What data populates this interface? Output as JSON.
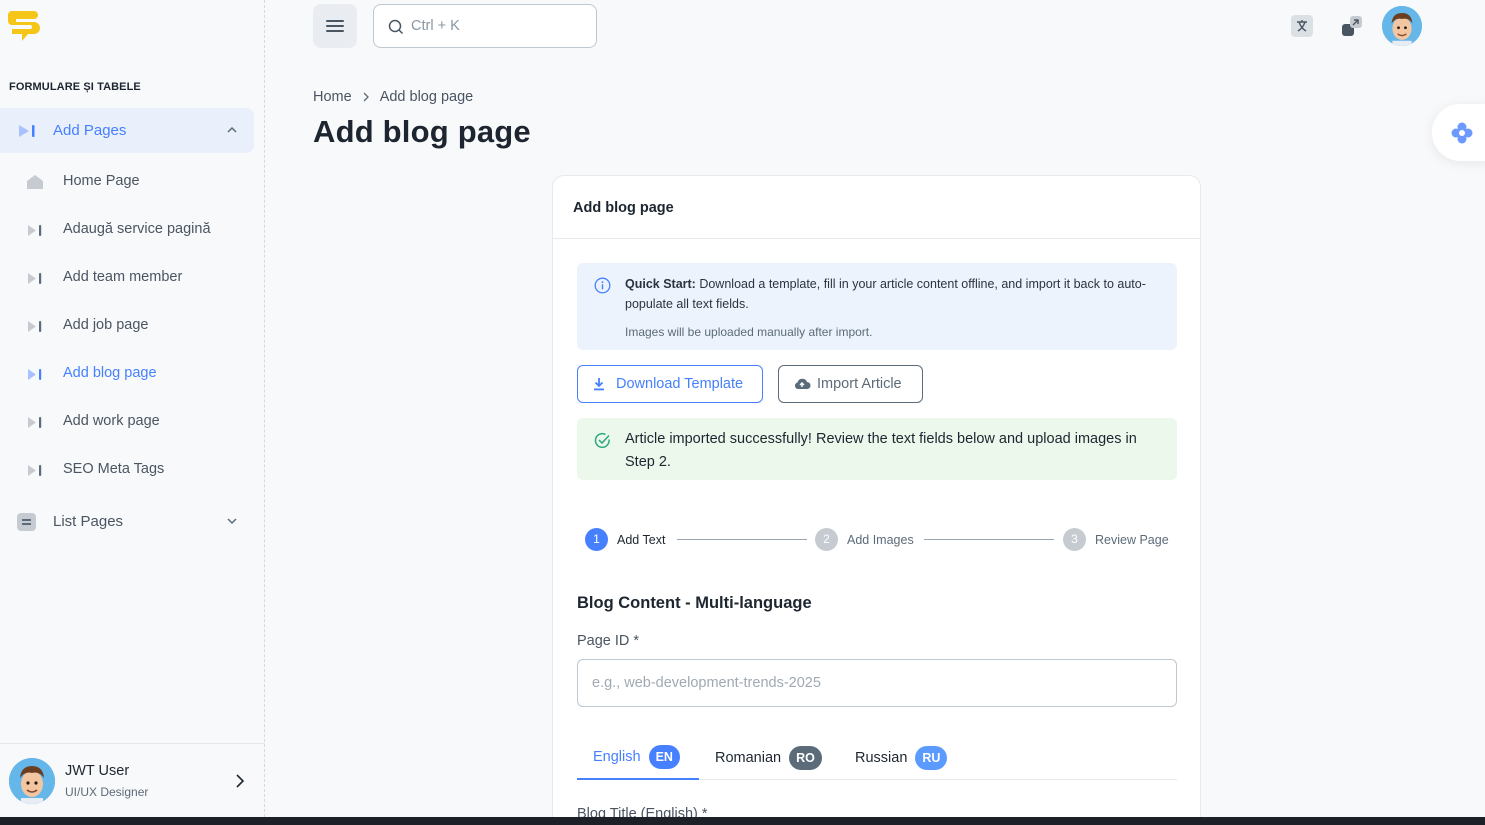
{
  "sidebar": {
    "section_label": "FORMULARE ȘI TABELE",
    "parent": {
      "label": "Add Pages",
      "icon": "play-bar-icon"
    },
    "items": [
      {
        "label": "Home Page",
        "icon": "home-icon"
      },
      {
        "label": "Adaugă service pagină",
        "icon": "play-bar-icon"
      },
      {
        "label": "Add team member",
        "icon": "play-bar-icon"
      },
      {
        "label": "Add job page",
        "icon": "play-bar-icon"
      },
      {
        "label": "Add blog page",
        "icon": "play-bar-icon",
        "active": true
      },
      {
        "label": "Add work page",
        "icon": "play-bar-icon"
      },
      {
        "label": "SEO Meta Tags",
        "icon": "play-bar-icon"
      }
    ],
    "list_parent": {
      "label": "List Pages",
      "icon": "list-icon"
    },
    "user": {
      "name": "JWT User",
      "role": "UI/UX Designer"
    }
  },
  "header": {
    "search_placeholder": "Ctrl + K"
  },
  "breadcrumb": {
    "home": "Home",
    "current": "Add blog page"
  },
  "page_title": "Add blog page",
  "card": {
    "title": "Add blog page",
    "info": {
      "bold": "Quick Start:",
      "text": " Download a template, fill in your article content offline, and import it back to auto-populate all text fields.",
      "sub": "Images will be uploaded manually after import."
    },
    "buttons": {
      "download": "Download Template",
      "import": "Import Article"
    },
    "success": "Article imported successfully! Review the text fields below and upload images in Step 2.",
    "steps": [
      {
        "num": "1",
        "label": "Add Text",
        "active": true
      },
      {
        "num": "2",
        "label": "Add Images",
        "active": false
      },
      {
        "num": "3",
        "label": "Review Page",
        "active": false
      }
    ],
    "section_title": "Blog Content - Multi-language",
    "page_id_label": "Page ID *",
    "page_id_placeholder": "e.g., web-development-trends-2025",
    "tabs": [
      {
        "label": "English",
        "badge": "EN",
        "active": true
      },
      {
        "label": "Romanian",
        "badge": "RO",
        "active": false
      },
      {
        "label": "Russian",
        "badge": "RU",
        "active": false
      }
    ],
    "next_field_label": "Blog Title (English) *"
  },
  "colors": {
    "primary": "#4680ff",
    "secondary": "#5b6b79",
    "success": "#2ca87f",
    "badge_ro": "#5b6b79",
    "badge_ru": "#5b9bff"
  }
}
